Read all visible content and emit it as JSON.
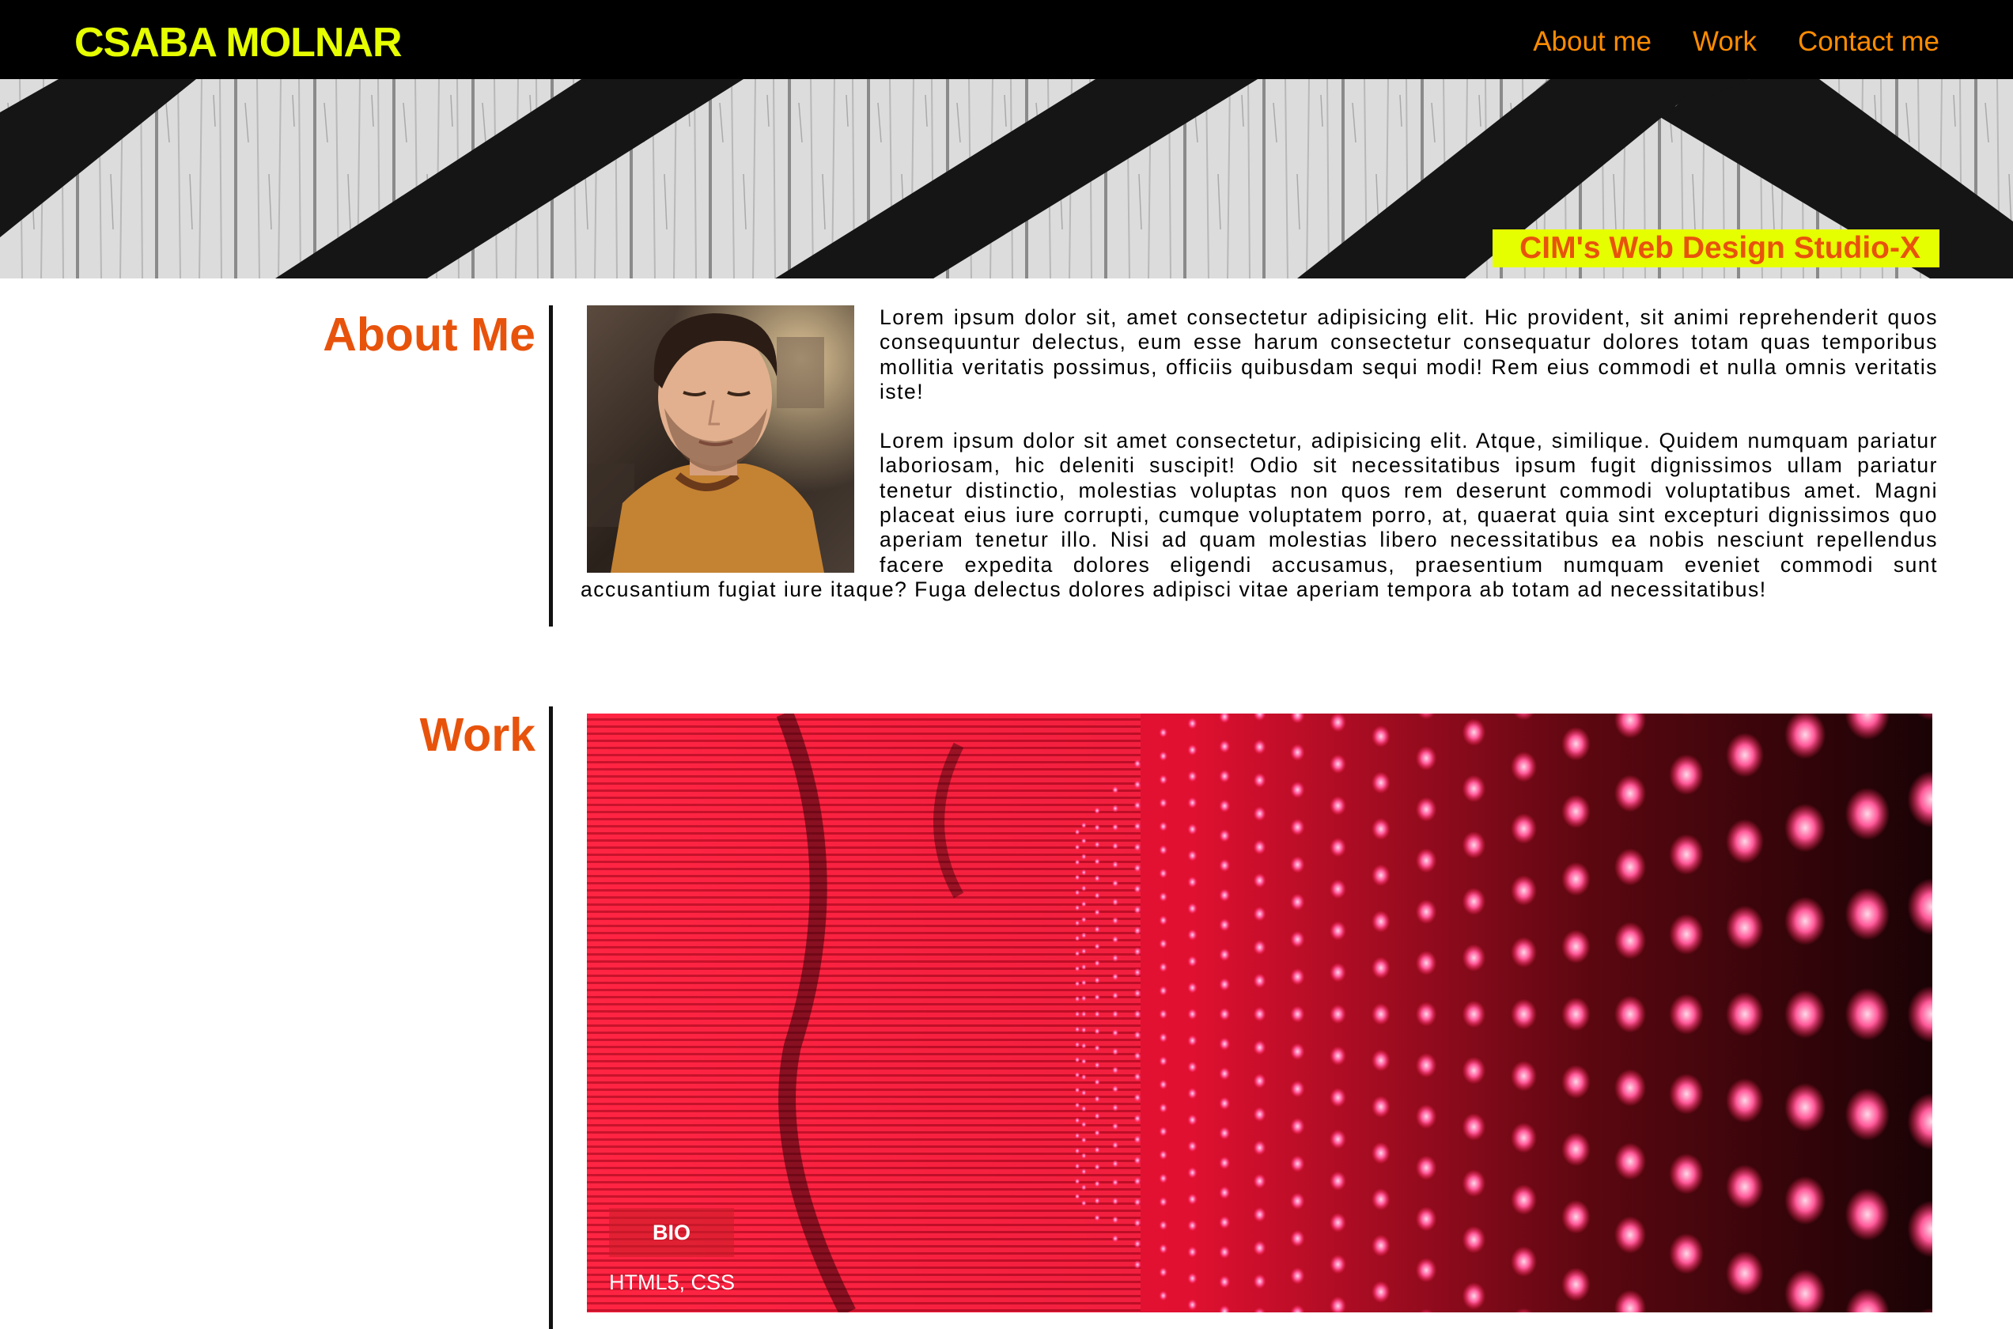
{
  "header": {
    "brand": "CSABA MOLNAR",
    "nav": [
      "About me",
      "Work",
      "Contact me"
    ]
  },
  "hero": {
    "tagline": "CIM's Web Design Studio-X"
  },
  "about": {
    "title": "About Me",
    "paragraphs": [
      "Lorem ipsum dolor sit, amet consectetur adipisicing elit. Hic provident, sit animi reprehenderit quos consequuntur delectus, eum esse harum consectetur consequatur dolores totam quas temporibus mollitia veritatis possimus, officiis quibusdam sequi modi! Rem eius commodi et nulla omnis veritatis iste!",
      "Lorem ipsum dolor sit amet consectetur, adipisicing elit. Atque, similique. Quidem numquam pariatur laboriosam, hic deleniti suscipit! Odio sit necessitatibus ipsum fugit dignissimos ullam pariatur tenetur distinctio, molestias voluptas non quos rem deserunt commodi voluptatibus amet. Magni placeat eius iure corrupti, cumque voluptatem porro, at, quaerat quia sint excepturi dignissimos quo aperiam tenetur illo. Nisi ad quam molestias libero necessitatibus ea nobis nesciunt repellendus facere expedita dolores eligendi accusamus, praesentium numquam eveniet commodi sunt accusantium fugiat iure itaque? Fuga delectus dolores adipisci vitae aperiam tempora ab totam ad necessitatibus!"
    ]
  },
  "work": {
    "title": "Work",
    "projects": [
      {
        "label": "BIO",
        "tags": "HTML5, CSS"
      }
    ]
  },
  "colors": {
    "header_bg": "#000000",
    "brand": "#e6ff00",
    "nav_link": "#ff8c00",
    "section_title": "#e8530c",
    "tagline_bg": "#e6ff00",
    "tagline_text": "#e8530c"
  },
  "icons": {
    "hero": "striped-wood-wall-image",
    "portrait": "profile-photo",
    "work_thumbnail": "red-led-wall-image"
  }
}
